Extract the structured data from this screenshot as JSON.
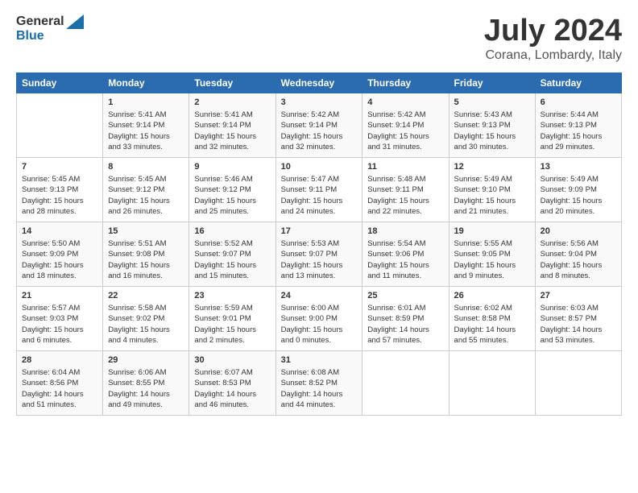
{
  "header": {
    "logo_general": "General",
    "logo_blue": "Blue",
    "month": "July 2024",
    "location": "Corana, Lombardy, Italy"
  },
  "days_of_week": [
    "Sunday",
    "Monday",
    "Tuesday",
    "Wednesday",
    "Thursday",
    "Friday",
    "Saturday"
  ],
  "weeks": [
    [
      {
        "day": "",
        "info": ""
      },
      {
        "day": "1",
        "info": "Sunrise: 5:41 AM\nSunset: 9:14 PM\nDaylight: 15 hours\nand 33 minutes."
      },
      {
        "day": "2",
        "info": "Sunrise: 5:41 AM\nSunset: 9:14 PM\nDaylight: 15 hours\nand 32 minutes."
      },
      {
        "day": "3",
        "info": "Sunrise: 5:42 AM\nSunset: 9:14 PM\nDaylight: 15 hours\nand 32 minutes."
      },
      {
        "day": "4",
        "info": "Sunrise: 5:42 AM\nSunset: 9:14 PM\nDaylight: 15 hours\nand 31 minutes."
      },
      {
        "day": "5",
        "info": "Sunrise: 5:43 AM\nSunset: 9:13 PM\nDaylight: 15 hours\nand 30 minutes."
      },
      {
        "day": "6",
        "info": "Sunrise: 5:44 AM\nSunset: 9:13 PM\nDaylight: 15 hours\nand 29 minutes."
      }
    ],
    [
      {
        "day": "7",
        "info": "Sunrise: 5:45 AM\nSunset: 9:13 PM\nDaylight: 15 hours\nand 28 minutes."
      },
      {
        "day": "8",
        "info": "Sunrise: 5:45 AM\nSunset: 9:12 PM\nDaylight: 15 hours\nand 26 minutes."
      },
      {
        "day": "9",
        "info": "Sunrise: 5:46 AM\nSunset: 9:12 PM\nDaylight: 15 hours\nand 25 minutes."
      },
      {
        "day": "10",
        "info": "Sunrise: 5:47 AM\nSunset: 9:11 PM\nDaylight: 15 hours\nand 24 minutes."
      },
      {
        "day": "11",
        "info": "Sunrise: 5:48 AM\nSunset: 9:11 PM\nDaylight: 15 hours\nand 22 minutes."
      },
      {
        "day": "12",
        "info": "Sunrise: 5:49 AM\nSunset: 9:10 PM\nDaylight: 15 hours\nand 21 minutes."
      },
      {
        "day": "13",
        "info": "Sunrise: 5:49 AM\nSunset: 9:09 PM\nDaylight: 15 hours\nand 20 minutes."
      }
    ],
    [
      {
        "day": "14",
        "info": "Sunrise: 5:50 AM\nSunset: 9:09 PM\nDaylight: 15 hours\nand 18 minutes."
      },
      {
        "day": "15",
        "info": "Sunrise: 5:51 AM\nSunset: 9:08 PM\nDaylight: 15 hours\nand 16 minutes."
      },
      {
        "day": "16",
        "info": "Sunrise: 5:52 AM\nSunset: 9:07 PM\nDaylight: 15 hours\nand 15 minutes."
      },
      {
        "day": "17",
        "info": "Sunrise: 5:53 AM\nSunset: 9:07 PM\nDaylight: 15 hours\nand 13 minutes."
      },
      {
        "day": "18",
        "info": "Sunrise: 5:54 AM\nSunset: 9:06 PM\nDaylight: 15 hours\nand 11 minutes."
      },
      {
        "day": "19",
        "info": "Sunrise: 5:55 AM\nSunset: 9:05 PM\nDaylight: 15 hours\nand 9 minutes."
      },
      {
        "day": "20",
        "info": "Sunrise: 5:56 AM\nSunset: 9:04 PM\nDaylight: 15 hours\nand 8 minutes."
      }
    ],
    [
      {
        "day": "21",
        "info": "Sunrise: 5:57 AM\nSunset: 9:03 PM\nDaylight: 15 hours\nand 6 minutes."
      },
      {
        "day": "22",
        "info": "Sunrise: 5:58 AM\nSunset: 9:02 PM\nDaylight: 15 hours\nand 4 minutes."
      },
      {
        "day": "23",
        "info": "Sunrise: 5:59 AM\nSunset: 9:01 PM\nDaylight: 15 hours\nand 2 minutes."
      },
      {
        "day": "24",
        "info": "Sunrise: 6:00 AM\nSunset: 9:00 PM\nDaylight: 15 hours\nand 0 minutes."
      },
      {
        "day": "25",
        "info": "Sunrise: 6:01 AM\nSunset: 8:59 PM\nDaylight: 14 hours\nand 57 minutes."
      },
      {
        "day": "26",
        "info": "Sunrise: 6:02 AM\nSunset: 8:58 PM\nDaylight: 14 hours\nand 55 minutes."
      },
      {
        "day": "27",
        "info": "Sunrise: 6:03 AM\nSunset: 8:57 PM\nDaylight: 14 hours\nand 53 minutes."
      }
    ],
    [
      {
        "day": "28",
        "info": "Sunrise: 6:04 AM\nSunset: 8:56 PM\nDaylight: 14 hours\nand 51 minutes."
      },
      {
        "day": "29",
        "info": "Sunrise: 6:06 AM\nSunset: 8:55 PM\nDaylight: 14 hours\nand 49 minutes."
      },
      {
        "day": "30",
        "info": "Sunrise: 6:07 AM\nSunset: 8:53 PM\nDaylight: 14 hours\nand 46 minutes."
      },
      {
        "day": "31",
        "info": "Sunrise: 6:08 AM\nSunset: 8:52 PM\nDaylight: 14 hours\nand 44 minutes."
      },
      {
        "day": "",
        "info": ""
      },
      {
        "day": "",
        "info": ""
      },
      {
        "day": "",
        "info": ""
      }
    ]
  ]
}
